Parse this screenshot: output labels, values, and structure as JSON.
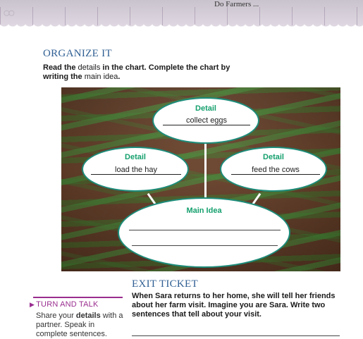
{
  "header": {
    "running_text": "Do Farmers ...",
    "section_title": "ORGANIZE IT",
    "instruction": {
      "part1": "Read the",
      "part2": "details",
      "part3": "in the chart. Complete the chart by writing",
      "part4": "the",
      "part5": "main idea",
      "part6": "."
    }
  },
  "chart": {
    "detail_top": {
      "title": "Detail",
      "answer": "collect eggs"
    },
    "detail_left": {
      "title": "Detail",
      "answer": "load the hay"
    },
    "detail_right": {
      "title": "Detail",
      "answer": "feed the cows"
    },
    "main_idea": {
      "title": "Main Idea"
    }
  },
  "exit_ticket": {
    "title": "EXIT TICKET",
    "prompt": "When Sara returns to her home, she will tell her friends about her farm visit. Imagine you are Sara. Write two sentences that tell about your visit."
  },
  "turn_and_talk": {
    "title": "TURN AND TALK",
    "text1": "Share your",
    "text_bold": "details",
    "text2": "with a partner. Speak in complete sentences."
  },
  "colors": {
    "heading_blue": "#2f5f93",
    "oval_border": "#1c8c7a",
    "detail_green": "#15a06e",
    "turn_talk_purple": "#9a2d8f"
  }
}
